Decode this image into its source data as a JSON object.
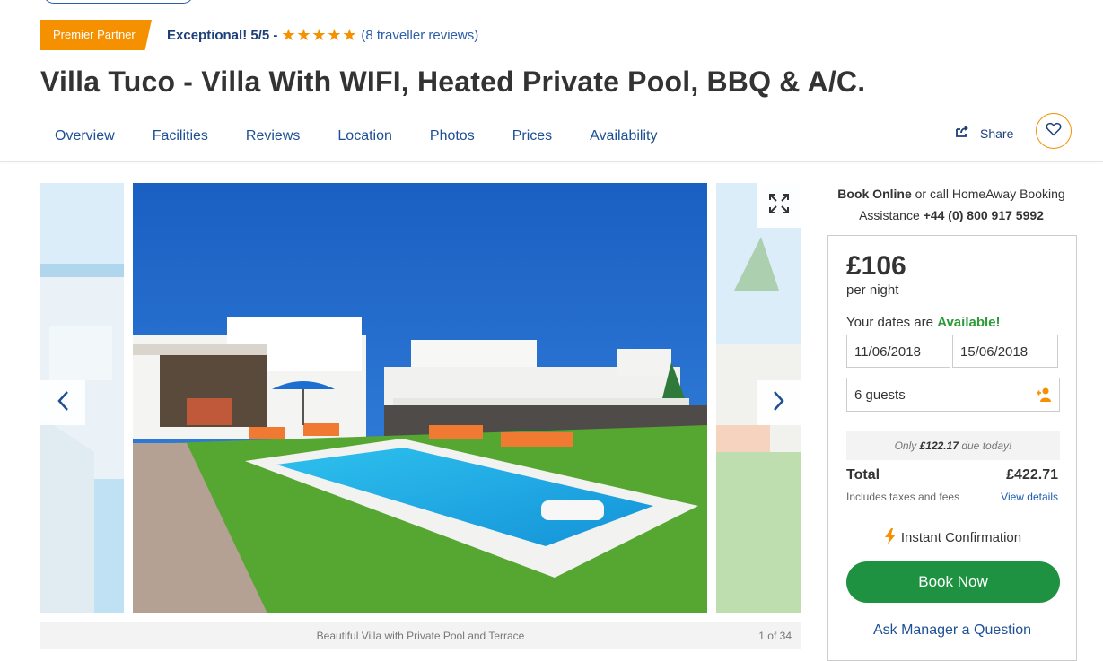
{
  "header": {
    "badge": "Premier Partner",
    "rating_label": "Exceptional! 5/5 -",
    "stars": 5,
    "reviews": "(8 traveller reviews)",
    "title": "Villa Tuco - Villa With WIFI, Heated Private Pool, BBQ & A/C."
  },
  "tabs": [
    "Overview",
    "Facilities",
    "Reviews",
    "Location",
    "Photos",
    "Prices",
    "Availability"
  ],
  "actions": {
    "share": "Share"
  },
  "gallery": {
    "caption": "Beautiful Villa with Private Pool and Terrace",
    "counter": "1 of 34"
  },
  "booking": {
    "call_bold": "Book Online",
    "call_mid": " or call HomeAway Booking Assistance ",
    "call_phone": "+44 (0) 800 917 5992",
    "price": "£106",
    "per": "per night",
    "dates_prefix": "Your dates are ",
    "dates_status": "Available!",
    "date_from": "11/06/2018",
    "date_to": "15/06/2018",
    "guests": "6 guests",
    "due_prefix": "Only ",
    "due_amount": "£122.17",
    "due_suffix": " due today!",
    "total_label": "Total",
    "total_value": "£422.71",
    "taxes": "Includes taxes and fees",
    "view_details": "View details",
    "instant": "Instant Confirmation",
    "book_now": "Book Now",
    "ask": "Ask Manager a Question"
  },
  "colors": {
    "accent_orange": "#f59100",
    "nav_blue": "#1c4f93",
    "book_green": "#1e9240",
    "available_green": "#2e9a3b"
  }
}
